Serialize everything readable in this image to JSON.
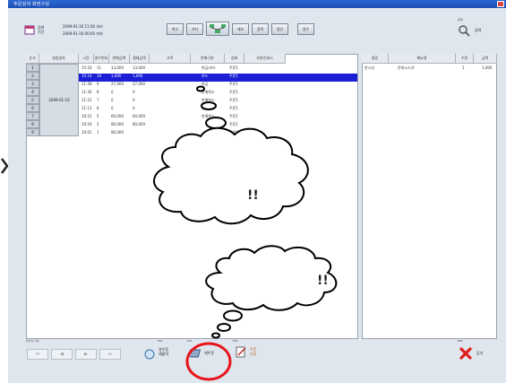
{
  "window": {
    "title": "주문검색 화면구성"
  },
  "toolbar": {
    "date_label": "검색\n기간",
    "date_from": "2009-01-16 11:00 부터",
    "date_to": "2009-01-16 00:00 까지",
    "buttons": [
      "취소",
      "기타",
      "전체",
      "재조",
      "검색",
      "정산"
    ],
    "extra_button": "영수",
    "search_caption": "검색",
    "search_label": "검색"
  },
  "left_table": {
    "headers": [
      "순서",
      "영업일자",
      "시간",
      "영수번호",
      "판매금액",
      "결제금액",
      "고객",
      "판매구분",
      "상태",
      "부분인쇄시"
    ],
    "row_numbers": [
      "1",
      "2",
      "3",
      "4",
      "5",
      "6",
      "7",
      "8",
      "9"
    ],
    "date_cell": "2009-01-16",
    "rows": [
      [
        "15:16",
        "11",
        "13,000",
        "13,000",
        "",
        "현금/카드",
        "주문1"
      ],
      [
        "15:14",
        "10",
        "1,000",
        "1,000",
        "",
        "카드",
        "주문1"
      ],
      [
        "11:58",
        "9",
        "27,000",
        "27,000",
        "",
        "현금",
        "주문1"
      ],
      [
        "11:36",
        "8",
        "0",
        "0",
        "",
        "판매취소",
        "주문1"
      ],
      [
        "11:21",
        "7",
        "0",
        "0",
        "",
        "판매취소",
        "주문1"
      ],
      [
        "11:11",
        "6",
        "0",
        "0",
        "",
        "판매취소",
        "주문1"
      ],
      [
        "10:21",
        "5",
        "60,000",
        "60,000",
        "",
        "판매취소",
        "주문1"
      ],
      [
        "10:24",
        "2",
        "80,000",
        "80,000",
        "",
        "",
        "주문1"
      ],
      [
        "10:01",
        "1",
        "80,000",
        "",
        "",
        "",
        "주문1"
      ]
    ]
  },
  "right_table": {
    "headers": [
      "종류",
      "메뉴명",
      "수량",
      "금액"
    ],
    "rows": [
      [
        "판시부",
        "문화소스카",
        "1",
        "1,000"
      ]
    ]
  },
  "bottom": {
    "caption_left": "페이지 이동",
    "f_keys": [
      "F10",
      "F11",
      "F12"
    ],
    "btn_labels": [
      "영수증\n재출력",
      "재주문",
      "판매\n취소",
      "주문\n보류"
    ],
    "reorder_label": "재주문",
    "close_caption": "ESC",
    "close_label": "닫기"
  },
  "annotations": {
    "bubble1": "!!",
    "bubble2": "!!"
  },
  "colors": {
    "selected_row": "#1a1fd6",
    "title_bar": "#1b4fb5",
    "highlight_circle": "#e8141c"
  }
}
